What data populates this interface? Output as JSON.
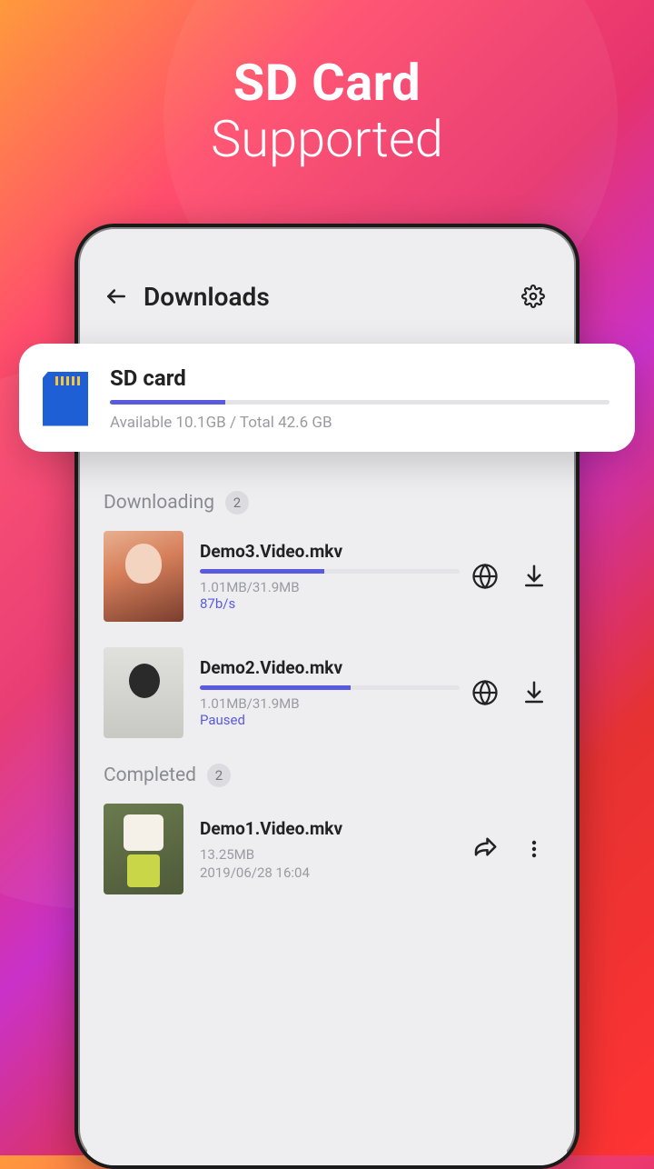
{
  "hero": {
    "title": "SD Card",
    "subtitle": "Supported"
  },
  "appbar": {
    "title": "Downloads"
  },
  "sdcard": {
    "title": "SD card",
    "info": "Available 10.1GB / Total 42.6 GB",
    "fill_percent": 23
  },
  "sections": {
    "downloading": {
      "label": "Downloading",
      "count": "2"
    },
    "completed": {
      "label": "Completed",
      "count": "2"
    }
  },
  "downloading_items": [
    {
      "title": "Demo3.Video.mkv",
      "size": "1.01MB/31.9MB",
      "status": "87b/s",
      "progress": 48
    },
    {
      "title": "Demo2.Video.mkv",
      "size": "1.01MB/31.9MB",
      "status": "Paused",
      "progress": 58
    }
  ],
  "completed_items": [
    {
      "title": "Demo1.Video.mkv",
      "size": "13.25MB",
      "date": "2019/06/28   16:04"
    }
  ]
}
